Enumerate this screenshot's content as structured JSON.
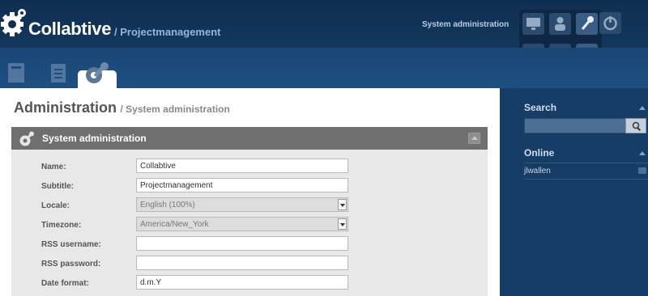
{
  "app": {
    "title": "Collabtive",
    "subtitle": "/ Projectmanagement"
  },
  "header": {
    "system_admin_link": "System administration",
    "quick_icons": [
      "monitor-icon",
      "user-icon",
      "wrench-icon",
      "power-icon",
      "calendar-icon",
      "contact-icon",
      "admin-gear-icon"
    ]
  },
  "tabs": {
    "items": [
      "projects-tab-icon",
      "tasks-tab-icon",
      "admin-tab-icon"
    ]
  },
  "page": {
    "title": "Administration",
    "breadcrumb": "/ System administration"
  },
  "panel": {
    "title": "System administration",
    "fields": [
      {
        "label": "Name:",
        "value": "Collabtive",
        "type": "text"
      },
      {
        "label": "Subtitle:",
        "value": "Projectmanagement",
        "type": "text"
      },
      {
        "label": "Locale:",
        "value": "English (100%)",
        "type": "select"
      },
      {
        "label": "Timezone:",
        "value": "America/New_York",
        "type": "select"
      },
      {
        "label": "RSS username:",
        "value": "",
        "type": "text"
      },
      {
        "label": "RSS password:",
        "value": "",
        "type": "password"
      },
      {
        "label": "Date format:",
        "value": "d.m.Y",
        "type": "text"
      }
    ]
  },
  "sidebar": {
    "search_title": "Search",
    "online_title": "Online",
    "online_users": [
      "jlwallen"
    ]
  },
  "colors": {
    "header_bg": "#0f2f52",
    "sidebar_bg": "#163d66",
    "panel_head": "#6f6f6f",
    "accent_text": "#8fb8de"
  }
}
